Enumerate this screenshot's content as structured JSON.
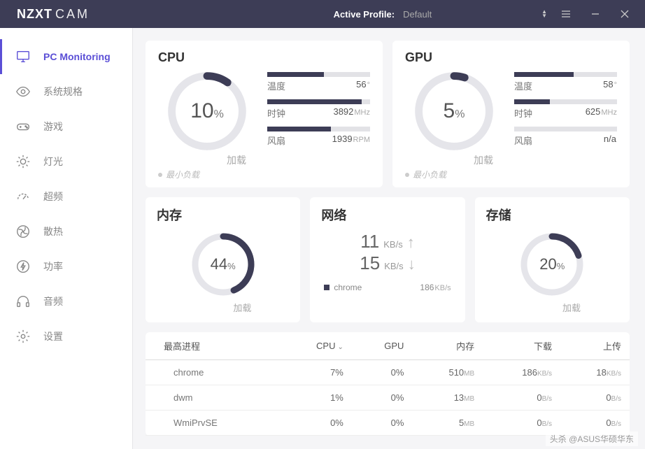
{
  "titlebar": {
    "brand_bold": "NZXT",
    "brand_thin": "CAM",
    "profile_label": "Active Profile:",
    "profile_value": "Default"
  },
  "sidebar": {
    "items": [
      {
        "label": "PC Monitoring"
      },
      {
        "label": "系统规格"
      },
      {
        "label": "游戏"
      },
      {
        "label": "灯光"
      },
      {
        "label": "超频"
      },
      {
        "label": "散热"
      },
      {
        "label": "功率"
      },
      {
        "label": "音频"
      },
      {
        "label": "设置"
      }
    ]
  },
  "cpu": {
    "title": "CPU",
    "load_pct": 10,
    "load_label": "加载",
    "sub_label": "最小负载",
    "stats": [
      {
        "label": "温度",
        "value": "56",
        "unit": "°",
        "fill": 55
      },
      {
        "label": "时钟",
        "value": "3892",
        "unit": "MHz",
        "fill": 92
      },
      {
        "label": "风扇",
        "value": "1939",
        "unit": "RPM",
        "fill": 62
      }
    ]
  },
  "gpu": {
    "title": "GPU",
    "load_pct": 5,
    "load_label": "加载",
    "sub_label": "最小负载",
    "stats": [
      {
        "label": "温度",
        "value": "58",
        "unit": "°",
        "fill": 58
      },
      {
        "label": "时钟",
        "value": "625",
        "unit": "MHz",
        "fill": 35
      },
      {
        "label": "风扇",
        "value": "n/a",
        "unit": "",
        "fill": 0
      }
    ]
  },
  "mem": {
    "title": "内存",
    "pct": 44,
    "label": "加载"
  },
  "net": {
    "title": "网络",
    "up_val": "11",
    "up_unit": "KB/s",
    "down_val": "15",
    "down_unit": "KB/s",
    "proc": "chrome",
    "proc_val": "186",
    "proc_unit": "KB/s"
  },
  "storage": {
    "title": "存储",
    "pct": 20,
    "label": "加载"
  },
  "table": {
    "headers": [
      "最高进程",
      "CPU",
      "GPU",
      "内存",
      "下载",
      "上传"
    ],
    "rows": [
      {
        "name": "chrome",
        "cpu": "7%",
        "gpu": "0%",
        "mem": "510",
        "mem_u": "MB",
        "dl": "186",
        "dl_u": "KB/s",
        "ul": "18",
        "ul_u": "KB/s"
      },
      {
        "name": "dwm",
        "cpu": "1%",
        "gpu": "0%",
        "mem": "13",
        "mem_u": "MB",
        "dl": "0",
        "dl_u": "B/s",
        "ul": "0",
        "ul_u": "B/s"
      },
      {
        "name": "WmiPrvSE",
        "cpu": "0%",
        "gpu": "0%",
        "mem": "5",
        "mem_u": "MB",
        "dl": "0",
        "dl_u": "B/s",
        "ul": "0",
        "ul_u": "B/s"
      }
    ]
  },
  "watermark": "头杀 @ASUS华硕华东"
}
